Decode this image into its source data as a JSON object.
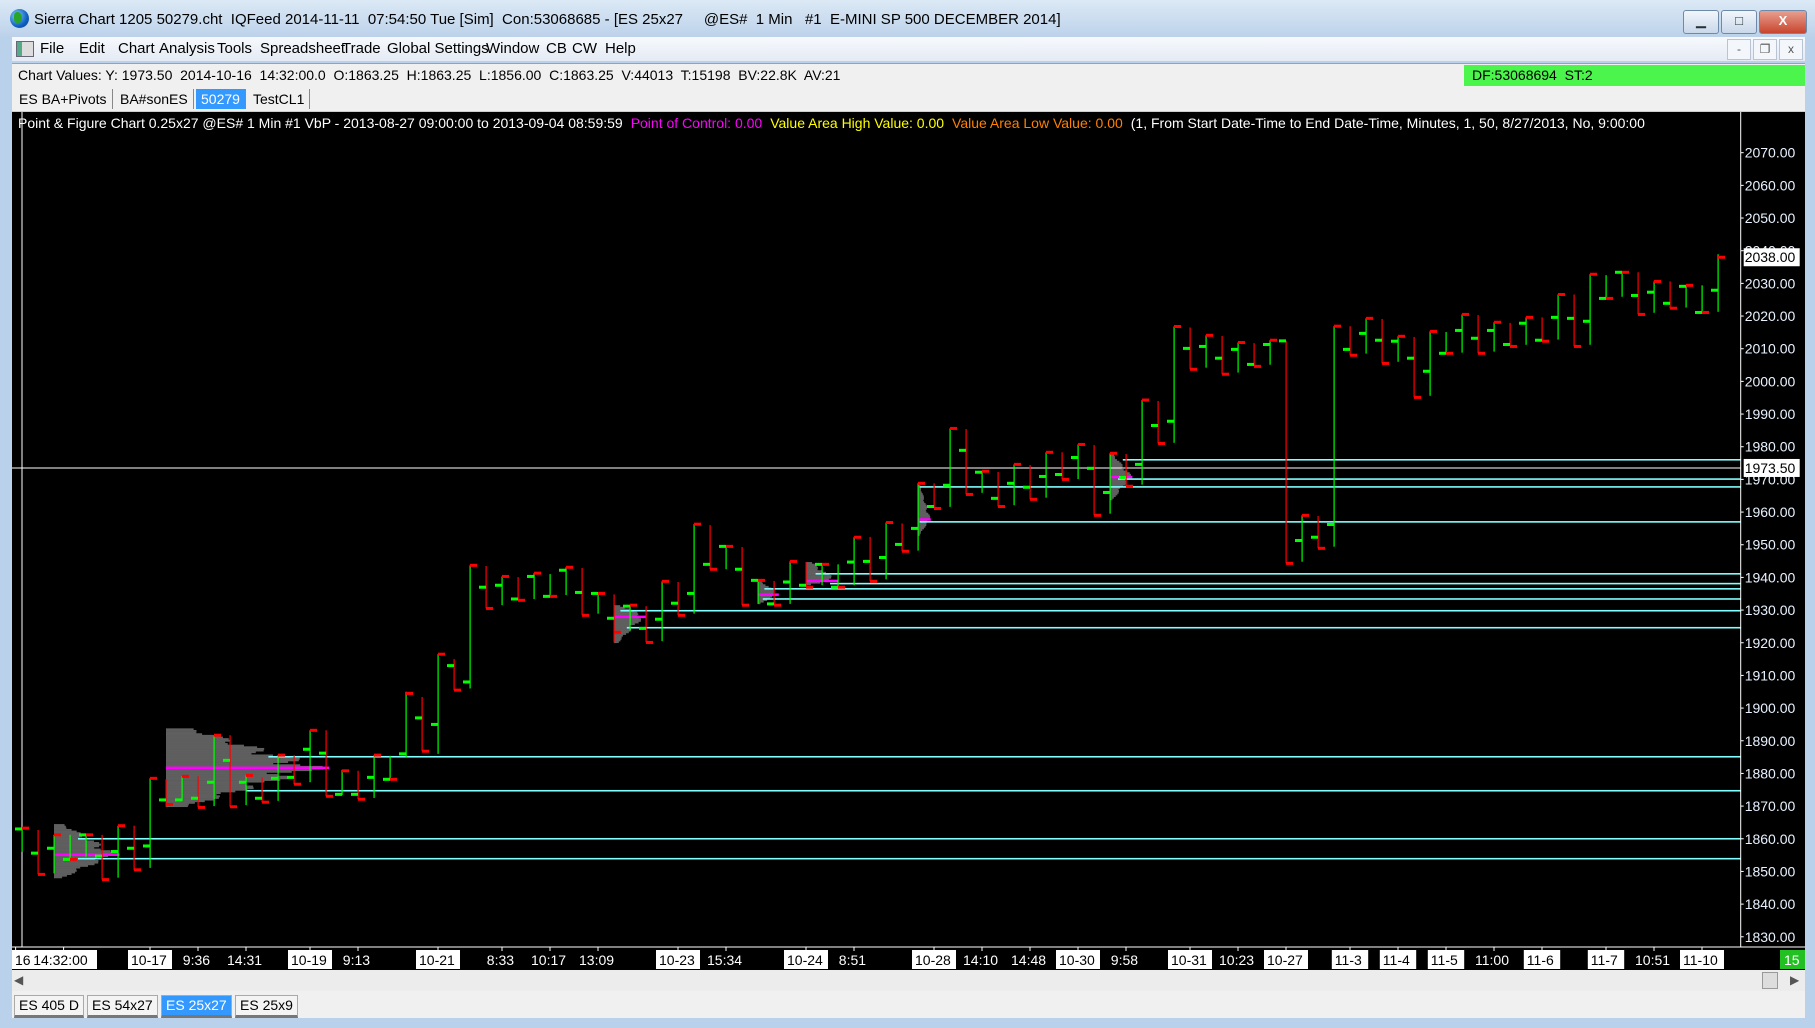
{
  "window": {
    "title": "Sierra Chart 1205 50279.cht  IQFeed 2014-11-11  07:54:50 Tue [Sim]  Con:53068685 - [ES 25x27     @ES#  1 Min   #1  E-MINI SP 500 DECEMBER 2014]",
    "minimize": "▁",
    "maximize": "□",
    "close": "X"
  },
  "menu": {
    "items": [
      "File",
      "Edit",
      "Chart",
      "Analysis",
      "Tools",
      "Spreadsheet",
      "Trade",
      "Global Settings",
      "Window",
      "CB",
      "CW",
      "Help"
    ],
    "mdi_minimize": "-",
    "mdi_restore": "❐",
    "mdi_close": "x"
  },
  "values_bar": {
    "text": "Chart Values: Y: 1973.50  2014-10-16  14:32:00.0  O:1863.25  H:1863.25  L:1856.00  C:1863.25  V:44013  T:15198  BV:22.8K  AV:21",
    "status": "DF:53068694  ST:2",
    "status_color": "#4cf54c"
  },
  "chart_tabs": [
    {
      "label": "ES BA+Pivots",
      "selected": false
    },
    {
      "label": "BA#sonES",
      "selected": false
    },
    {
      "label": "50279",
      "selected": true
    },
    {
      "label": "TestCL1",
      "selected": false
    }
  ],
  "chart_header": {
    "study": "Point & Figure Chart 0.25x27 @ES#  1 Min   #1 VbP - 2013-08-27  09:00:00 to 2013-09-04  08:59:59",
    "poc": "Point of Control: 0.00",
    "vah": "Value Area High Value: 0.00",
    "val": "Value Area Low Value: 0.00",
    "params": "(1, From Start Date-Time to End Date-Time, Minutes, 1, 50, 8/27/2013, No, 9:00:00",
    "colors": {
      "study": "#ffffff",
      "poc": "#ff00ff",
      "vah": "#ffff00",
      "val": "#ff8000",
      "params": "#ffffff"
    }
  },
  "bottom_tabs": [
    {
      "label": "ES 405 D",
      "selected": false
    },
    {
      "label": "ES 54x27",
      "selected": false
    },
    {
      "label": "ES 25x27",
      "selected": true
    },
    {
      "label": "ES 25x9",
      "selected": false
    }
  ],
  "chart_data": {
    "type": "ohlc",
    "bar_fields": [
      "open",
      "high",
      "low",
      "close"
    ],
    "ylim": [
      1826,
      2078
    ],
    "y_ticks": [
      1830,
      1840,
      1850,
      1860,
      1870,
      1880,
      1890,
      1900,
      1910,
      1920,
      1930,
      1940,
      1950,
      1960,
      1970,
      1980,
      1990,
      2000,
      2010,
      2020,
      2030,
      2040,
      2050,
      2060,
      2070
    ],
    "y_tick_format": "0.00",
    "last_price_label": "2038.00",
    "crosshair": {
      "price": 1973.5,
      "label": "1973.50",
      "bar": 0
    },
    "colors": {
      "up": "#00ff00",
      "down": "#ff0000",
      "open_tick": "#00ff00",
      "close_tick": "#ff0000",
      "value_area_line": "#7fffff",
      "profile": "#5f5f5f",
      "poc": "#ff00ff",
      "crosshair": "#ffffff"
    },
    "bars": [
      [
        1863,
        1863.25,
        1856,
        1863.25
      ],
      [
        1855.6,
        1862.7,
        1849.1,
        1849.1
      ],
      [
        1857.1,
        1861.2,
        1849.4,
        1861.2
      ],
      [
        1853.7,
        1861.2,
        1853.7,
        1853.7
      ],
      [
        1861.2,
        1861.2,
        1854.5,
        1861.2
      ],
      [
        1854.7,
        1861.2,
        1847.5,
        1847.5
      ],
      [
        1856.1,
        1864,
        1848.1,
        1864
      ],
      [
        1857.1,
        1864,
        1850.5,
        1850.5
      ],
      [
        1857.8,
        1878.5,
        1851.1,
        1878.5
      ],
      [
        1871.9,
        1878.2,
        1869.8,
        1870.5
      ],
      [
        1871.9,
        1879.1,
        1871.6,
        1879.1
      ],
      [
        1872.4,
        1879.1,
        1869.6,
        1869.6
      ],
      [
        1877.3,
        1891.7,
        1870,
        1891.7
      ],
      [
        1884,
        1891.7,
        1869.8,
        1869.8
      ],
      [
        1877.3,
        1879.4,
        1870.3,
        1879.4
      ],
      [
        1872.4,
        1878.8,
        1871.2,
        1871.2
      ],
      [
        1878.5,
        1885.6,
        1871.6,
        1885.6
      ],
      [
        1878.8,
        1885.6,
        1876.7,
        1876.7
      ],
      [
        1887.4,
        1893.2,
        1877.3,
        1893.2
      ],
      [
        1886.2,
        1893.2,
        1873,
        1873
      ],
      [
        1873.6,
        1881.1,
        1873.4,
        1880.8
      ],
      [
        1873.6,
        1880.8,
        1872.1,
        1872.1
      ],
      [
        1878.8,
        1885.6,
        1872.5,
        1885.6
      ],
      [
        1878.2,
        1885.4,
        1878.2,
        1878.2
      ],
      [
        1886,
        1905,
        1885,
        1904.5
      ],
      [
        1897,
        1903.4,
        1886.8,
        1886.8
      ],
      [
        1895,
        1916.5,
        1886,
        1916.5
      ],
      [
        1913,
        1915,
        1905.5,
        1905.5
      ],
      [
        1908,
        1943.7,
        1906,
        1943.7
      ],
      [
        1937,
        1943.5,
        1930.5,
        1930.5
      ],
      [
        1937.6,
        1940.3,
        1931.5,
        1940.3
      ],
      [
        1933.4,
        1940.1,
        1933,
        1933
      ],
      [
        1940.3,
        1941.3,
        1933.4,
        1941.3
      ],
      [
        1934.2,
        1941,
        1934.2,
        1934.2
      ],
      [
        1942.2,
        1943.1,
        1934.6,
        1943.1
      ],
      [
        1935.4,
        1942.9,
        1928.4,
        1928.4
      ],
      [
        1935.1,
        1935.1,
        1928.9,
        1935.1
      ],
      [
        1927.5,
        1934.8,
        1920.1,
        1923.2
      ],
      [
        1931.2,
        1931.5,
        1923.7,
        1931.5
      ],
      [
        1924.4,
        1931.2,
        1920.1,
        1920.1
      ],
      [
        1927.2,
        1938.8,
        1920.5,
        1938.8
      ],
      [
        1932.1,
        1938.6,
        1928.4,
        1928.4
      ],
      [
        1935.1,
        1956.3,
        1928.9,
        1956.3
      ],
      [
        1944,
        1956,
        1942.5,
        1942.5
      ],
      [
        1949.5,
        1949.5,
        1942.5,
        1949.5
      ],
      [
        1942.5,
        1949.3,
        1931.5,
        1931.5
      ],
      [
        1939.1,
        1939.1,
        1931.9,
        1939.1
      ],
      [
        1931.9,
        1938.9,
        1931.5,
        1931.5
      ],
      [
        1938.6,
        1944.9,
        1931.9,
        1944.9
      ],
      [
        1937.6,
        1944.7,
        1937,
        1937
      ],
      [
        1944,
        1944,
        1937.6,
        1944
      ],
      [
        1937,
        1944,
        1937,
        1937
      ],
      [
        1944.7,
        1952.3,
        1937.6,
        1952.3
      ],
      [
        1944.9,
        1952.4,
        1938.8,
        1938.8
      ],
      [
        1946.1,
        1956.8,
        1939.4,
        1956.8
      ],
      [
        1950.1,
        1956.5,
        1948,
        1948
      ],
      [
        1955,
        1968.8,
        1948.2,
        1968.8
      ],
      [
        1961.7,
        1968.8,
        1961.1,
        1961.1
      ],
      [
        1968.2,
        1985.6,
        1961.6,
        1985.6
      ],
      [
        1978.9,
        1985.4,
        1965.4,
        1965.4
      ],
      [
        1972.2,
        1972.5,
        1965.9,
        1972.5
      ],
      [
        1964.2,
        1972.3,
        1961.7,
        1961.7
      ],
      [
        1968.8,
        1974.6,
        1962.1,
        1974.6
      ],
      [
        1967.6,
        1974.4,
        1963.9,
        1963.9
      ],
      [
        1970.9,
        1978.3,
        1964.4,
        1978.3
      ],
      [
        1971.5,
        1978.3,
        1970,
        1970
      ],
      [
        1976.7,
        1980.7,
        1970.1,
        1980.7
      ],
      [
        1973.4,
        1980.5,
        1959,
        1959
      ],
      [
        1966,
        1978,
        1959.5,
        1978
      ],
      [
        1970.6,
        1977.8,
        1967.9,
        1967.9
      ],
      [
        1974.6,
        1994.3,
        1968.4,
        1994.3
      ],
      [
        1986.5,
        1994,
        1981,
        1981
      ],
      [
        1987.8,
        2016.8,
        1981.2,
        2016.8
      ],
      [
        2010.1,
        2016.5,
        2003.7,
        2003.7
      ],
      [
        2010.7,
        2014.1,
        2004.2,
        2014.1
      ],
      [
        2007.1,
        2013.9,
        2002.2,
        2002.2
      ],
      [
        2009.8,
        2011.9,
        2002.7,
        2011.9
      ],
      [
        2005.2,
        2011.7,
        2004.6,
        2004.6
      ],
      [
        2011.3,
        2012.6,
        2005.1,
        2012.6
      ],
      [
        2012.4,
        2012.4,
        1944.3,
        1944.3
      ],
      [
        1951.3,
        1959,
        1944.8,
        1959
      ],
      [
        1952.3,
        1958.8,
        1948.9,
        1948.9
      ],
      [
        1956.2,
        2016.9,
        1949.4,
        2016.9
      ],
      [
        2009.8,
        2016.9,
        2008,
        2008
      ],
      [
        2014.7,
        2019.3,
        2008.5,
        2019.3
      ],
      [
        2012.6,
        2019.1,
        2005.5,
        2005.5
      ],
      [
        2012.3,
        2013.8,
        2006,
        2013.8
      ],
      [
        2007.1,
        2013.6,
        1995.1,
        1995.1
      ],
      [
        2003.1,
        2015.3,
        1995.6,
        2015.3
      ],
      [
        2008.6,
        2015.1,
        2008.6,
        2008.6
      ],
      [
        2015.6,
        2020.5,
        2008.8,
        2020.5
      ],
      [
        2013.2,
        2020.3,
        2008.6,
        2008.6
      ],
      [
        2015.6,
        2018.1,
        2009.1,
        2018.1
      ],
      [
        2011.3,
        2017.9,
        2010.7,
        2010.7
      ],
      [
        2017.8,
        2019.6,
        2011.2,
        2019.6
      ],
      [
        2012.6,
        2019.6,
        2012.3,
        2012.3
      ],
      [
        2019.6,
        2026.6,
        2012.8,
        2026.6
      ],
      [
        2019.3,
        2026.6,
        2010.7,
        2010.7
      ],
      [
        2018.4,
        2032.8,
        2011.2,
        2032.8
      ],
      [
        2025.4,
        2032.5,
        2025.4,
        2025.4
      ],
      [
        2033.4,
        2033.4,
        2025.9,
        2033.4
      ],
      [
        2026.3,
        2033.4,
        2020.5,
        2020.5
      ],
      [
        2027.3,
        2030.6,
        2021,
        2030.6
      ],
      [
        2023.9,
        2030.6,
        2022.4,
        2022.4
      ],
      [
        2029.1,
        2029.4,
        2022.6,
        2029.4
      ],
      [
        2021.1,
        2029.4,
        2021.1,
        2021.1
      ],
      [
        2027.9,
        2038.9,
        2021.3,
        2038
      ]
    ],
    "value_area_lines": [
      {
        "price": 1860.0,
        "from_bar": 3.5
      },
      {
        "price": 1853.9,
        "from_bar": 3.5
      },
      {
        "price": 1885.1,
        "from_bar": 15.4
      },
      {
        "price": 1874.7,
        "from_bar": 14
      },
      {
        "price": 1941.1,
        "from_bar": 49.6
      },
      {
        "price": 1938.1,
        "from_bar": 50.5
      },
      {
        "price": 1936.5,
        "from_bar": 46.4
      },
      {
        "price": 1933.4,
        "from_bar": 46.3
      },
      {
        "price": 1929.8,
        "from_bar": 37.4
      },
      {
        "price": 1924.6,
        "from_bar": 37.8
      },
      {
        "price": 1976.0,
        "from_bar": 68.8
      },
      {
        "price": 1970.1,
        "from_bar": 68.5
      },
      {
        "price": 1967.7,
        "from_bar": 56.1
      },
      {
        "price": 1957.0,
        "from_bar": 56.1
      }
    ],
    "volume_profiles": [
      {
        "bar": 2,
        "low": 1848,
        "high": 1864.2,
        "poc": 1855.2,
        "max_width_bars": 4.1
      },
      {
        "bar": 9,
        "low": 1869.8,
        "high": 1893.6,
        "poc": 1881.8,
        "max_width_bars": 10.2
      },
      {
        "bar": 37,
        "low": 1920,
        "high": 1931.5,
        "poc": 1928,
        "max_width_bars": 2
      },
      {
        "bar": 46,
        "low": 1931.9,
        "high": 1938.7,
        "poc": 1934.8,
        "max_width_bars": 1.3
      },
      {
        "bar": 49,
        "low": 1937.7,
        "high": 1944.5,
        "poc": 1939,
        "max_width_bars": 2
      },
      {
        "bar": 56,
        "low": 1952.8,
        "high": 1968.3,
        "poc": 1957.8,
        "max_width_bars": 0.8
      },
      {
        "bar": 68,
        "low": 1963.7,
        "high": 1977.5,
        "poc": 1970.8,
        "max_width_bars": 1.4
      }
    ],
    "x_labels": [
      {
        "text": "16",
        "bar": -0.4,
        "date": true
      },
      {
        "text": "14:32:00",
        "bar": 2.6,
        "date": true
      },
      {
        "text": "10-17",
        "bar": 8,
        "date": true
      },
      {
        "text": "9:36",
        "bar": 11,
        "date": false
      },
      {
        "text": "14:31",
        "bar": 14,
        "date": false
      },
      {
        "text": "10-19",
        "bar": 18,
        "date": true
      },
      {
        "text": "9:13",
        "bar": 21,
        "date": false
      },
      {
        "text": "10-21",
        "bar": 26,
        "date": true
      },
      {
        "text": "8:33",
        "bar": 30,
        "date": false
      },
      {
        "text": "10:17",
        "bar": 33,
        "date": false
      },
      {
        "text": "13:09",
        "bar": 36,
        "date": false
      },
      {
        "text": "10-23",
        "bar": 41,
        "date": true
      },
      {
        "text": "15:34",
        "bar": 44,
        "date": false
      },
      {
        "text": "10-24",
        "bar": 49,
        "date": true
      },
      {
        "text": "8:51",
        "bar": 52,
        "date": false
      },
      {
        "text": "10-28",
        "bar": 57,
        "date": true
      },
      {
        "text": "14:10",
        "bar": 60,
        "date": false
      },
      {
        "text": "14:48",
        "bar": 63,
        "date": false
      },
      {
        "text": "10-30",
        "bar": 66,
        "date": true
      },
      {
        "text": "9:58",
        "bar": 69,
        "date": false
      },
      {
        "text": "10-31",
        "bar": 73,
        "date": true
      },
      {
        "text": "10:23",
        "bar": 76,
        "date": false
      },
      {
        "text": "10-27",
        "bar": 79,
        "date": true
      },
      {
        "text": "11-3",
        "bar": 83,
        "date": true
      },
      {
        "text": "11-4",
        "bar": 86,
        "date": true
      },
      {
        "text": "11-5",
        "bar": 89,
        "date": true
      },
      {
        "text": "11:00",
        "bar": 92,
        "date": false
      },
      {
        "text": "11-6",
        "bar": 95,
        "date": true
      },
      {
        "text": "11-7",
        "bar": 99,
        "date": true
      },
      {
        "text": "10:51",
        "bar": 102,
        "date": false
      },
      {
        "text": "11-10",
        "bar": 105,
        "date": true
      }
    ],
    "x_axis_right_label": "15"
  }
}
